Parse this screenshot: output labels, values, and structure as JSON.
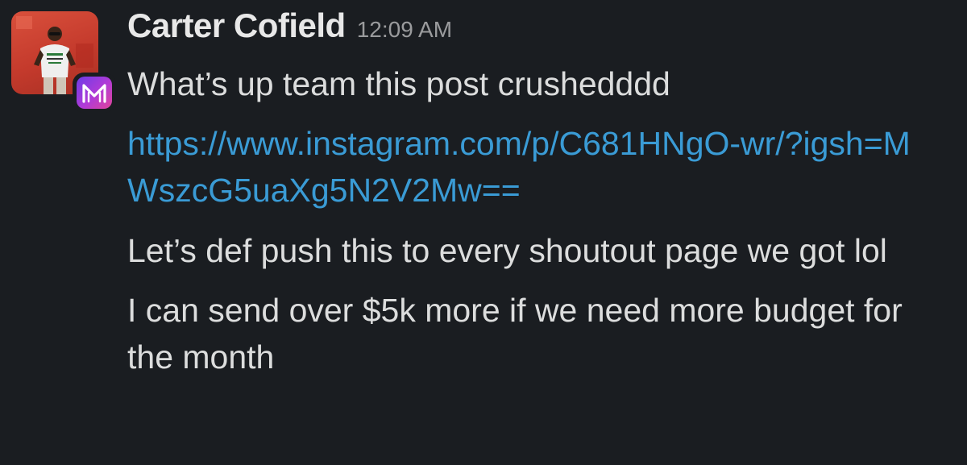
{
  "message": {
    "author": "Carter Cofield",
    "timestamp": "12:09 AM",
    "app_badge_icon": "m-logo-icon",
    "lines": [
      "What’s up team this post crushedddd",
      "https://www.instagram.com/p/C681HNgO-wr/?igsh=MWszcG5uaXg5N2V2Mw==",
      "Let’s def push this to every shoutout page we got lol",
      "I can send over $5k more if we need more budget for the month"
    ]
  },
  "colors": {
    "background": "#1a1d21",
    "text": "#dcdddd",
    "link": "#3a9bd5",
    "timestamp": "#9a9b9d"
  }
}
